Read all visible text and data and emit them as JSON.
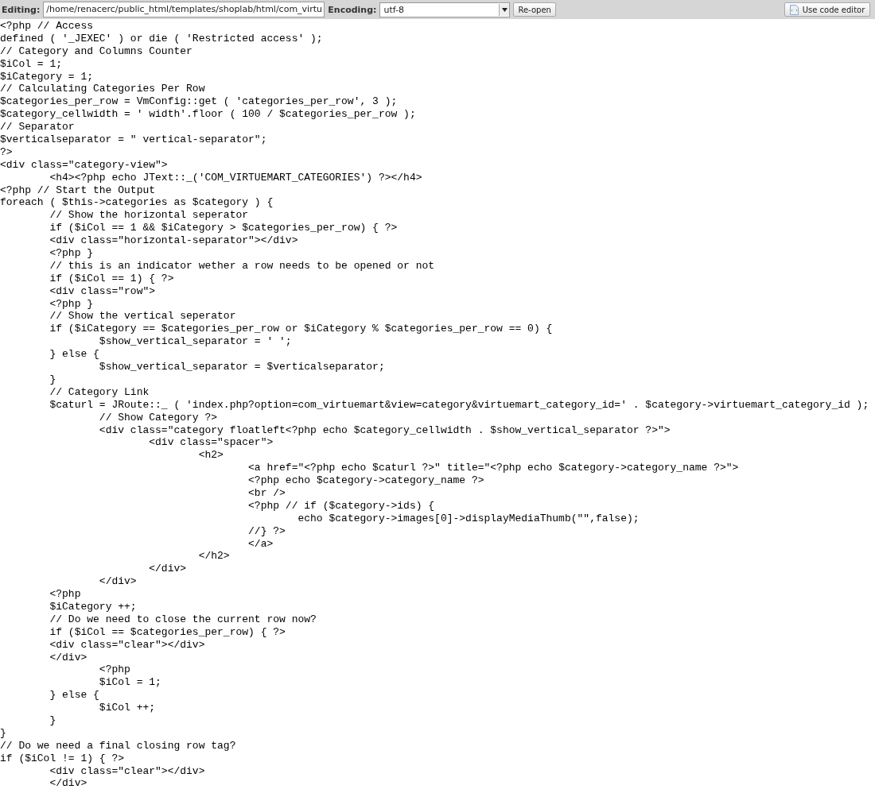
{
  "toolbar": {
    "editing_label": "Editing:",
    "path": "/home/renacerc/public_html/templates/shoplab/html/com_virtu",
    "encoding_label": "Encoding:",
    "encoding": "utf-8",
    "reopen_button": "Re-open",
    "code_editor_button": "Use code editor"
  },
  "code_lines": [
    "<?php // Access",
    "defined ( '_JEXEC' ) or die ( 'Restricted access' );",
    "// Category and Columns Counter",
    "$iCol = 1;",
    "$iCategory = 1;",
    "// Calculating Categories Per Row",
    "$categories_per_row = VmConfig::get ( 'categories_per_row', 3 );",
    "$category_cellwidth = ' width'.floor ( 100 / $categories_per_row );",
    "// Separator",
    "$verticalseparator = \" vertical-separator\";",
    "?>",
    "<div class=\"category-view\">",
    "\t<h4><?php echo JText::_('COM_VIRTUEMART_CATEGORIES') ?></h4>",
    "<?php // Start the Output",
    "foreach ( $this->categories as $category ) {",
    "\t// Show the horizontal seperator",
    "\tif ($iCol == 1 && $iCategory > $categories_per_row) { ?>",
    "\t<div class=\"horizontal-separator\"></div>",
    "\t<?php }",
    "\t// this is an indicator wether a row needs to be opened or not",
    "\tif ($iCol == 1) { ?>",
    "\t<div class=\"row\">",
    "\t<?php }",
    "\t// Show the vertical seperator",
    "\tif ($iCategory == $categories_per_row or $iCategory % $categories_per_row == 0) {",
    "\t\t$show_vertical_separator = ' ';",
    "\t} else {",
    "\t\t$show_vertical_separator = $verticalseparator;",
    "\t}",
    "\t// Category Link",
    "\t$caturl = JRoute::_ ( 'index.php?option=com_virtuemart&view=category&virtuemart_category_id=' . $category->virtuemart_category_id );",
    "\t\t// Show Category ?>",
    "\t\t<div class=\"category floatleft<?php echo $category_cellwidth . $show_vertical_separator ?>\">",
    "\t\t\t<div class=\"spacer\">",
    "\t\t\t\t<h2>",
    "\t\t\t\t\t<a href=\"<?php echo $caturl ?>\" title=\"<?php echo $category->category_name ?>\">",
    "\t\t\t\t\t<?php echo $category->category_name ?>",
    "\t\t\t\t\t<br />",
    "\t\t\t\t\t<?php // if ($category->ids) {",
    "\t\t\t\t\t\techo $category->images[0]->displayMediaThumb(\"\",false);",
    "\t\t\t\t\t//} ?>",
    "\t\t\t\t\t</a>",
    "\t\t\t\t</h2>",
    "\t\t\t</div>",
    "\t\t</div>",
    "\t<?php",
    "\t$iCategory ++;",
    "\t// Do we need to close the current row now?",
    "\tif ($iCol == $categories_per_row) { ?>",
    "\t<div class=\"clear\"></div>",
    "\t</div>",
    "\t\t<?php",
    "\t\t$iCol = 1;",
    "\t} else {",
    "\t\t$iCol ++;",
    "\t}",
    "}",
    "// Do we need a final closing row tag?",
    "if ($iCol != 1) { ?>",
    "\t<div class=\"clear\"></div>",
    "\t</div>"
  ]
}
